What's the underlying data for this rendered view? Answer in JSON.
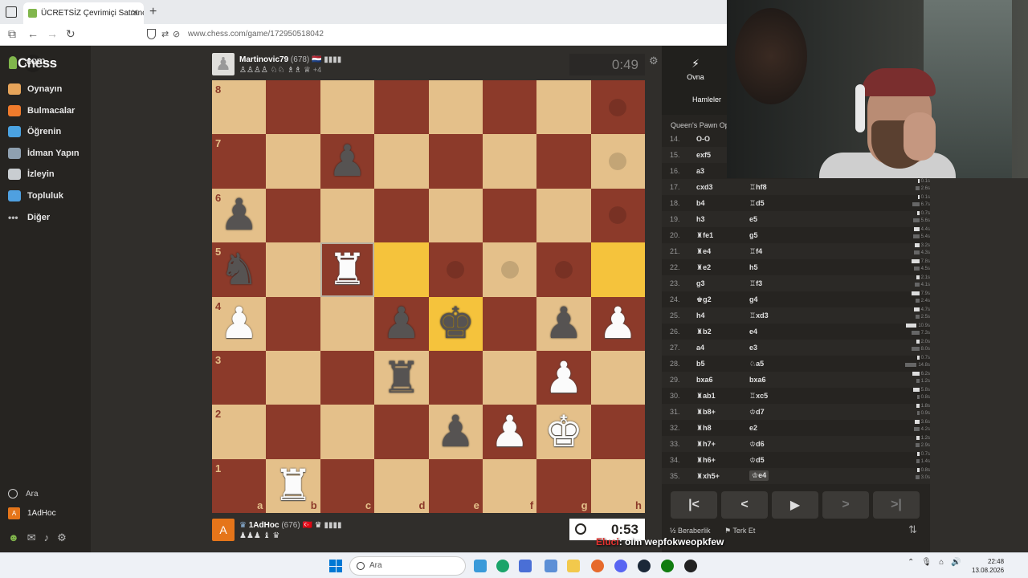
{
  "browser": {
    "tab_title": "ÜCRETSİZ Çevrimiçi Satranç Oy",
    "url": "www.chess.com/game/172950518042"
  },
  "sidebar": {
    "logo_main": "Chess",
    "logo_suffix": ".com",
    "items": [
      {
        "label": "Oynayın",
        "icon": "play-icon",
        "color": "#e6a45a"
      },
      {
        "label": "Bulmacalar",
        "icon": "puzzle-icon",
        "color": "#f07b2c"
      },
      {
        "label": "Öğrenin",
        "icon": "learn-icon",
        "color": "#4ba3e2"
      },
      {
        "label": "İdman Yapın",
        "icon": "train-icon",
        "color": "#8fa0b0"
      },
      {
        "label": "İzleyin",
        "icon": "watch-icon",
        "color": "#c9cdd1"
      },
      {
        "label": "Topluluk",
        "icon": "community-icon",
        "color": "#4fa0e0"
      },
      {
        "label": "Diğer",
        "icon": "more-icon",
        "color": "#bbbbbb"
      }
    ],
    "search_label": "Ara",
    "user_initial": "A",
    "username": "1AdHoc"
  },
  "top_player": {
    "name": "Martinovic79",
    "rating": "(678)",
    "flag": "🇳🇱",
    "captured": "♙♙♙♙ ♘♘ ♗♗ ♕",
    "advantage": "+4",
    "clock": "0:49"
  },
  "bottom_player": {
    "initial": "A",
    "name": "1AdHoc",
    "rating": "(676)",
    "flag": "🇹🇷",
    "captured": "♟♟♟ ♝ ♛",
    "clock": "0:53"
  },
  "board": {
    "ranks": [
      "8",
      "7",
      "6",
      "5",
      "4",
      "3",
      "2",
      "1"
    ],
    "files": [
      "a",
      "b",
      "c",
      "d",
      "e",
      "f",
      "g",
      "h"
    ],
    "pieces": {
      "c7": "bp",
      "a6": "bp",
      "a5": "bn",
      "c5": "wr",
      "a4": "wp",
      "d4": "bp",
      "e4": "bk",
      "g4": "bp",
      "h4": "wp",
      "d3": "br",
      "g3": "wp",
      "e2": "bp",
      "f2": "wp",
      "g2": "wk",
      "b1": "wr"
    },
    "highlighted": [
      "d5",
      "e4",
      "h5"
    ],
    "selected": "c5",
    "move_dots": [
      "h8",
      "h7",
      "h6",
      "e5",
      "f5",
      "g5"
    ],
    "colors": {
      "light": "#e4c08a",
      "dark": "#8c3a2a",
      "highlight": "#f5c33c"
    }
  },
  "panel": {
    "tab_play": "Ovna",
    "tab_moves": "Hamleler",
    "opening": "Queen's Pawn Ope",
    "moves": [
      {
        "no": "14.",
        "w": "O-O",
        "b": "",
        "tw": "",
        "tb": ""
      },
      {
        "no": "15.",
        "w": "exf5",
        "b": "",
        "tw": "",
        "tb": ""
      },
      {
        "no": "16.",
        "w": "a3",
        "b": "",
        "tw": "",
        "tb": ""
      },
      {
        "no": "17.",
        "w": "cxd3",
        "b": "♖hf8",
        "tw": "0.1s",
        "tb": "2.6s"
      },
      {
        "no": "18.",
        "w": "b4",
        "b": "♖d5",
        "tw": "0.1s",
        "tb": "6.7s"
      },
      {
        "no": "19.",
        "w": "h3",
        "b": "e5",
        "tw": "0.7s",
        "tb": "5.6s"
      },
      {
        "no": "20.",
        "w": "♜fe1",
        "b": "g5",
        "tw": "4.4s",
        "tb": "5.4s"
      },
      {
        "no": "21.",
        "w": "♜e4",
        "b": "♖f4",
        "tw": "3.2s",
        "tb": "4.3s"
      },
      {
        "no": "22.",
        "w": "♜e2",
        "b": "h5",
        "tw": "7.8s",
        "tb": "4.5s"
      },
      {
        "no": "23.",
        "w": "g3",
        "b": "♖f3",
        "tw": "2.1s",
        "tb": "4.1s"
      },
      {
        "no": "24.",
        "w": "♚g2",
        "b": "g4",
        "tw": "7.9s",
        "tb": "2.4s"
      },
      {
        "no": "25.",
        "w": "h4",
        "b": "♖xd3",
        "tw": "4.7s",
        "tb": "2.5s"
      },
      {
        "no": "26.",
        "w": "♜b2",
        "b": "e4",
        "tw": "10.9s",
        "tb": "7.3s"
      },
      {
        "no": "27.",
        "w": "a4",
        "b": "e3",
        "tw": "2.0s",
        "tb": "8.0s"
      },
      {
        "no": "28.",
        "w": "b5",
        "b": "♘a5",
        "tw": "0.7s",
        "tb": "14.8s"
      },
      {
        "no": "29.",
        "w": "bxa6",
        "b": "bxa6",
        "tw": "6.2s",
        "tb": "1.2s"
      },
      {
        "no": "30.",
        "w": "♜ab1",
        "b": "♖xc5",
        "tw": "5.8s",
        "tb": "0.8s"
      },
      {
        "no": "31.",
        "w": "♜b8+",
        "b": "♔d7",
        "tw": "1.8s",
        "tb": "0.9s"
      },
      {
        "no": "32.",
        "w": "♜h8",
        "b": "e2",
        "tw": "3.6s",
        "tb": "4.2s"
      },
      {
        "no": "33.",
        "w": "♜h7+",
        "b": "♔d6",
        "tw": "1.2s",
        "tb": "2.9s"
      },
      {
        "no": "34.",
        "w": "♜h6+",
        "b": "♔d5",
        "tw": "0.7s",
        "tb": "1.4s"
      },
      {
        "no": "35.",
        "w": "♜xh5+",
        "b": "♔e4",
        "tw": "0.8s",
        "tb": "3.0s"
      }
    ],
    "draw_label": "Beraberlik",
    "resign_label": "Terk Et"
  },
  "chat": {
    "user": "Eluci",
    "text": ": olm wepfokweopkfew"
  },
  "taskbar": {
    "search_placeholder": "Ara",
    "time": "22:48",
    "date": "13.08.2026"
  }
}
